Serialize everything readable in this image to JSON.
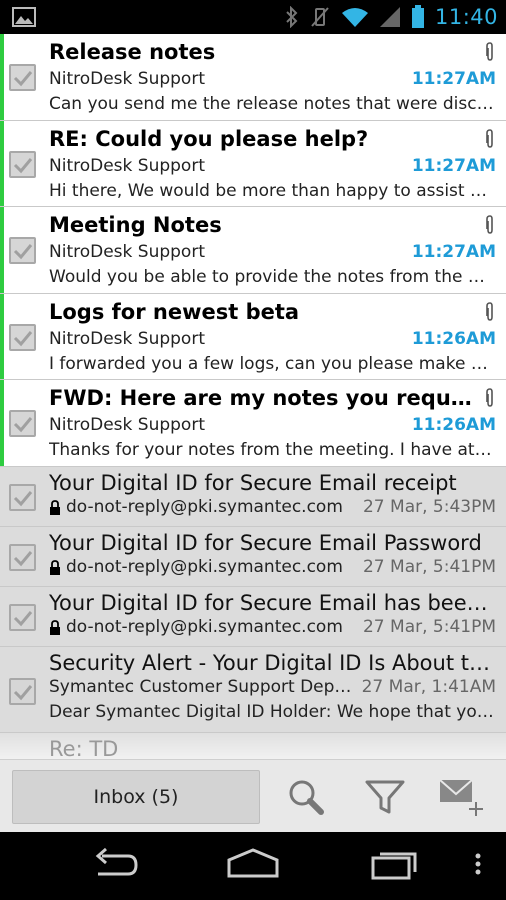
{
  "status_bar": {
    "time": "11:40",
    "icons": [
      "picture-icon",
      "bluetooth-icon",
      "vibrate-mute-icon",
      "wifi-icon",
      "signal-icon",
      "battery-icon"
    ]
  },
  "emails": [
    {
      "subject": "Release notes",
      "sender": "NitroDesk Support",
      "time": "11:27AM",
      "preview": "Can you send me the release notes that were discussed",
      "unread": true,
      "attachment": true
    },
    {
      "subject": "RE: Could you please help?",
      "sender": "NitroDesk Support",
      "time": "11:27AM",
      "preview": "Hi there, We would be more than happy to assist you. What",
      "unread": true,
      "attachment": true
    },
    {
      "subject": "Meeting Notes",
      "sender": "NitroDesk Support",
      "time": "11:27AM",
      "preview": "Would you be able to provide the notes from the meeting",
      "unread": true,
      "attachment": true
    },
    {
      "subject": "Logs for newest beta",
      "sender": "NitroDesk Support",
      "time": "11:26AM",
      "preview": "I forwarded you a few logs, can you please make sure",
      "unread": true,
      "attachment": true
    },
    {
      "subject": "FWD: Here are my notes you requested",
      "sender": "NitroDesk Support",
      "time": "11:26AM",
      "preview": "Thanks for your notes from the meeting. I have attached",
      "unread": true,
      "attachment": true
    },
    {
      "subject": "Your Digital ID for Secure Email receipt",
      "sender": "do-not-reply@pki.symantec.com",
      "time": "27 Mar, 5:43PM",
      "preview": "",
      "unread": false,
      "secure": true
    },
    {
      "subject": "Your Digital ID for Secure Email Password",
      "sender": "do-not-reply@pki.symantec.com",
      "time": "27 Mar, 5:41PM",
      "preview": "",
      "unread": false,
      "secure": true
    },
    {
      "subject": "Your Digital ID for Secure Email has been approved",
      "sender": "do-not-reply@pki.symantec.com",
      "time": "27 Mar, 5:41PM",
      "preview": "",
      "unread": false,
      "secure": true
    },
    {
      "subject": "Security Alert - Your Digital ID Is About to Expire",
      "sender": "Symantec Customer Support Department",
      "time": "27 Mar, 1:41AM",
      "preview": "Dear Symantec Digital ID Holder: We hope that you have",
      "unread": false,
      "secure": false
    }
  ],
  "partial_email": {
    "subject": "Re: TD"
  },
  "action_bar": {
    "inbox_label": "Inbox (5)",
    "icons": [
      "search-icon",
      "filter-icon",
      "compose-icon"
    ]
  },
  "nav_bar": {
    "icons": [
      "back-icon",
      "home-icon",
      "recents-icon",
      "overflow-menu-icon"
    ]
  },
  "colors": {
    "accent": "#33b5e5",
    "unread_marker": "#2ecc40",
    "time_unread": "#1e9bd7",
    "read_bg": "#dcdcdc"
  }
}
